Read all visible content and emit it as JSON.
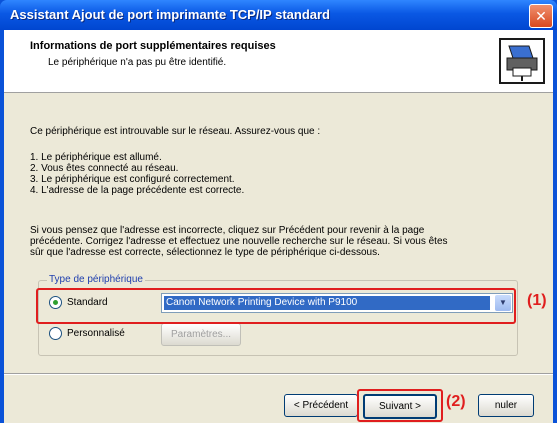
{
  "window": {
    "title": "Assistant Ajout de port imprimante TCP/IP standard",
    "close_glyph": "✕"
  },
  "header": {
    "title": "Informations de port supplémentaires requises",
    "subtitle": "Le périphérique n'a pas pu être identifié."
  },
  "body": {
    "intro": "Ce périphérique est introuvable sur le réseau. Assurez-vous que :",
    "checklist": [
      "1.  Le périphérique est allumé.",
      "2.  Vous êtes connecté au réseau.",
      "3.  Le périphérique est configuré correctement.",
      "4.  L'adresse de la page précédente est correcte."
    ],
    "para_lines": [
      "Si vous pensez que l'adresse est incorrecte, cliquez sur Précédent pour revenir à la page",
      "précédente. Corrigez l'adresse et effectuez une nouvelle recherche sur le réseau. Si vous êtes",
      "sûr que l'adresse est correcte, sélectionnez le type de périphérique ci-dessous."
    ]
  },
  "device_type": {
    "legend": "Type de périphérique",
    "standard_label": "Standard",
    "standard_selected": true,
    "standard_value": "Canon Network Printing Device with P9100",
    "custom_label": "Personnalisé",
    "custom_selected": false,
    "params_button": "Paramètres..."
  },
  "footer": {
    "back_button": "< Précédent",
    "next_button": "Suivant >",
    "cancel_button": "nuler"
  },
  "callouts": {
    "one": "(1)",
    "two": "(2)"
  },
  "colors": {
    "title_bar": "#0a58e4",
    "highlight": "#e01e1e",
    "selection": "#316ac5"
  },
  "icons": {
    "header": "printer-network-icon",
    "combo": "chevron-down-icon"
  }
}
